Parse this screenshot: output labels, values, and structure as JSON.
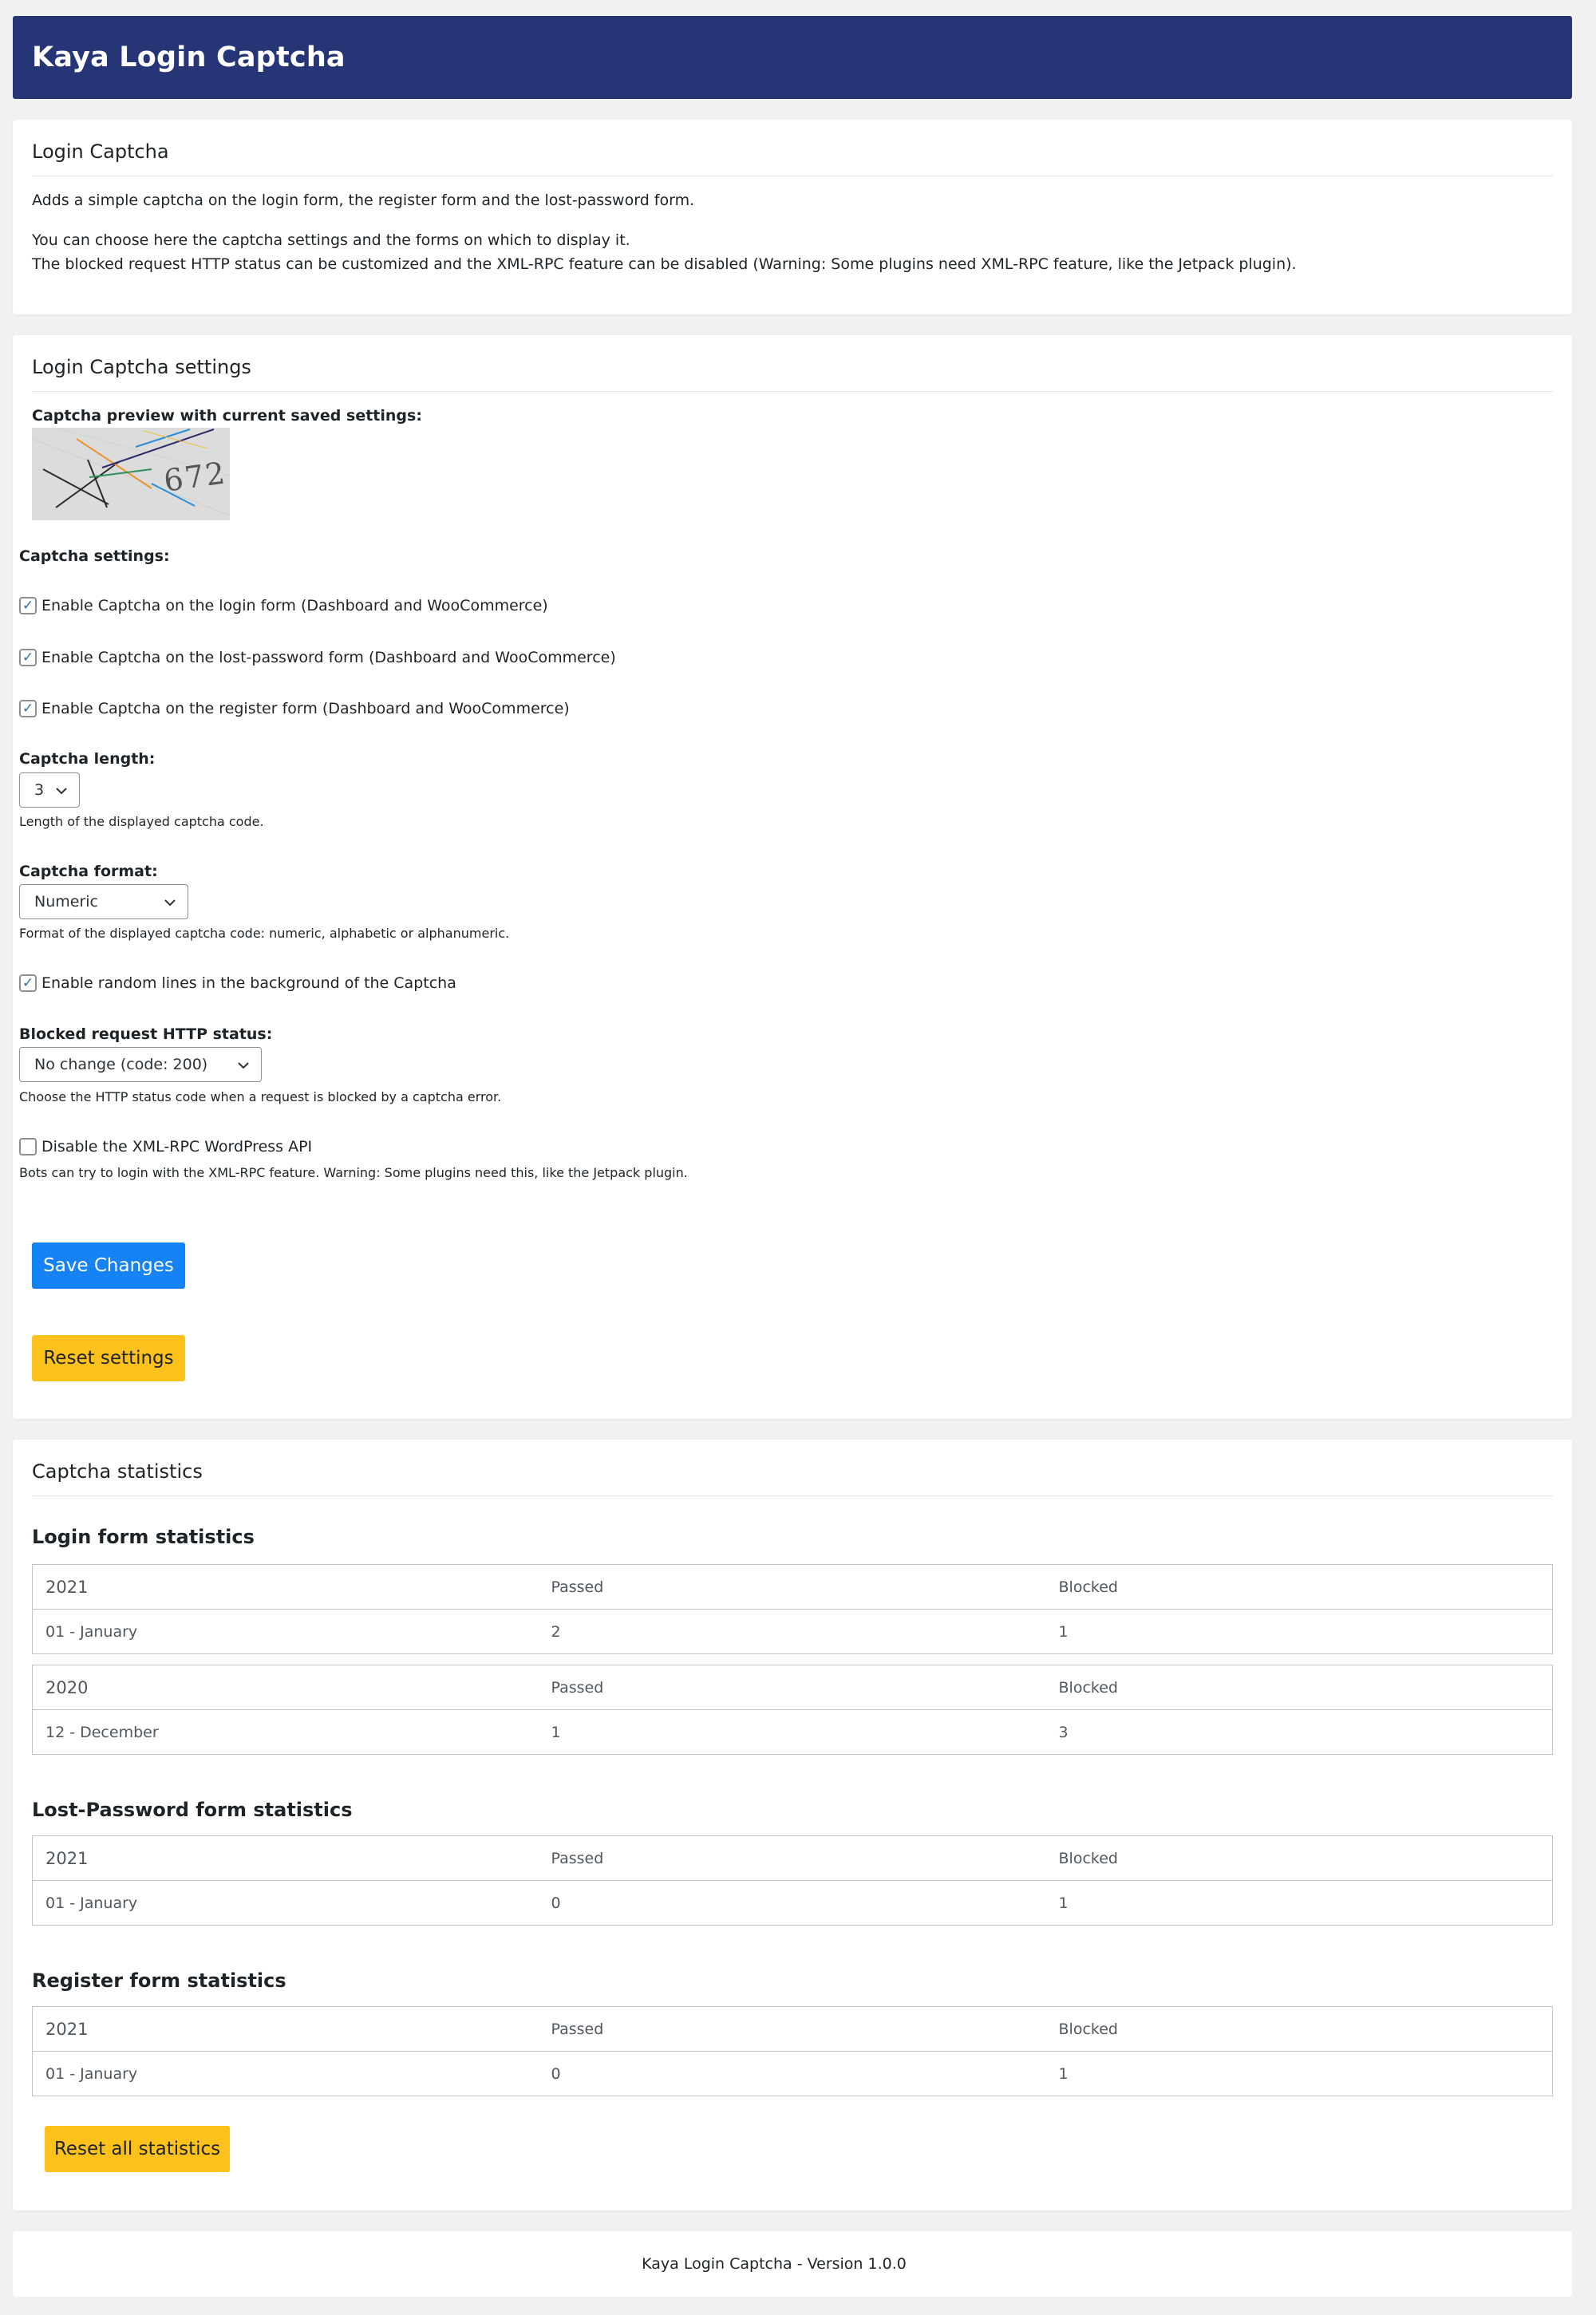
{
  "app": {
    "title": "Kaya Login Captcha"
  },
  "intro": {
    "title": "Login Captcha",
    "line1": "Adds a simple captcha on the login form, the register form and the lost-password form.",
    "line2": "You can choose here the captcha settings and the forms on which to display it.",
    "line3": "The blocked request HTTP status can be customized and the XML-RPC feature can be disabled (Warning: Some plugins need XML-RPC feature, like the Jetpack plugin)."
  },
  "settings": {
    "title": "Login Captcha settings",
    "preview_label": "Captcha preview with current saved settings:",
    "captcha_text": "672",
    "captcha_settings_label": "Captcha settings:",
    "checks": [
      {
        "label": "Enable Captcha on the login form (Dashboard and WooCommerce)",
        "checked": true
      },
      {
        "label": "Enable Captcha on the lost-password form (Dashboard and WooCommerce)",
        "checked": true
      },
      {
        "label": "Enable Captcha on the register form (Dashboard and WooCommerce)",
        "checked": true
      }
    ],
    "length_label": "Captcha length:",
    "length_value": "3",
    "length_help": "Length of the displayed captcha code.",
    "format_label": "Captcha format:",
    "format_value": "Numeric",
    "format_help": "Format of the displayed captcha code: numeric, alphabetic or alphanumeric.",
    "random_lines": {
      "label": "Enable random lines in the background of the Captcha",
      "checked": true
    },
    "http_label": "Blocked request HTTP status:",
    "http_value": "No change (code: 200)",
    "http_help": "Choose the HTTP status code when a request is blocked by a captcha error.",
    "xmlrpc": {
      "label": "Disable the XML-RPC WordPress API",
      "checked": false
    },
    "xmlrpc_help": "Bots can try to login with the XML-RPC feature. Warning: Some plugins need this, like the Jetpack plugin.",
    "save_label": "Save Changes",
    "reset_label": "Reset settings"
  },
  "stats": {
    "title": "Captcha statistics",
    "passed": "Passed",
    "blocked": "Blocked",
    "login": {
      "title": "Login form statistics",
      "tables": [
        {
          "year": "2021",
          "month": "01 - January",
          "passed": "2",
          "blocked": "1"
        },
        {
          "year": "2020",
          "month": "12 - December",
          "passed": "1",
          "blocked": "3"
        }
      ]
    },
    "lostpw": {
      "title": "Lost-Password form statistics",
      "tables": [
        {
          "year": "2021",
          "month": "01 - January",
          "passed": "0",
          "blocked": "1"
        }
      ]
    },
    "register": {
      "title": "Register form statistics",
      "tables": [
        {
          "year": "2021",
          "month": "01 - January",
          "passed": "0",
          "blocked": "1"
        }
      ]
    },
    "reset_label": "Reset all statistics"
  },
  "footer": {
    "text": "Kaya Login Captcha - Version 1.0.0"
  },
  "colors": {
    "header": "#263575",
    "primary": "#1582f6",
    "warning": "#fcc11a",
    "checkbox": "#2271b1"
  }
}
